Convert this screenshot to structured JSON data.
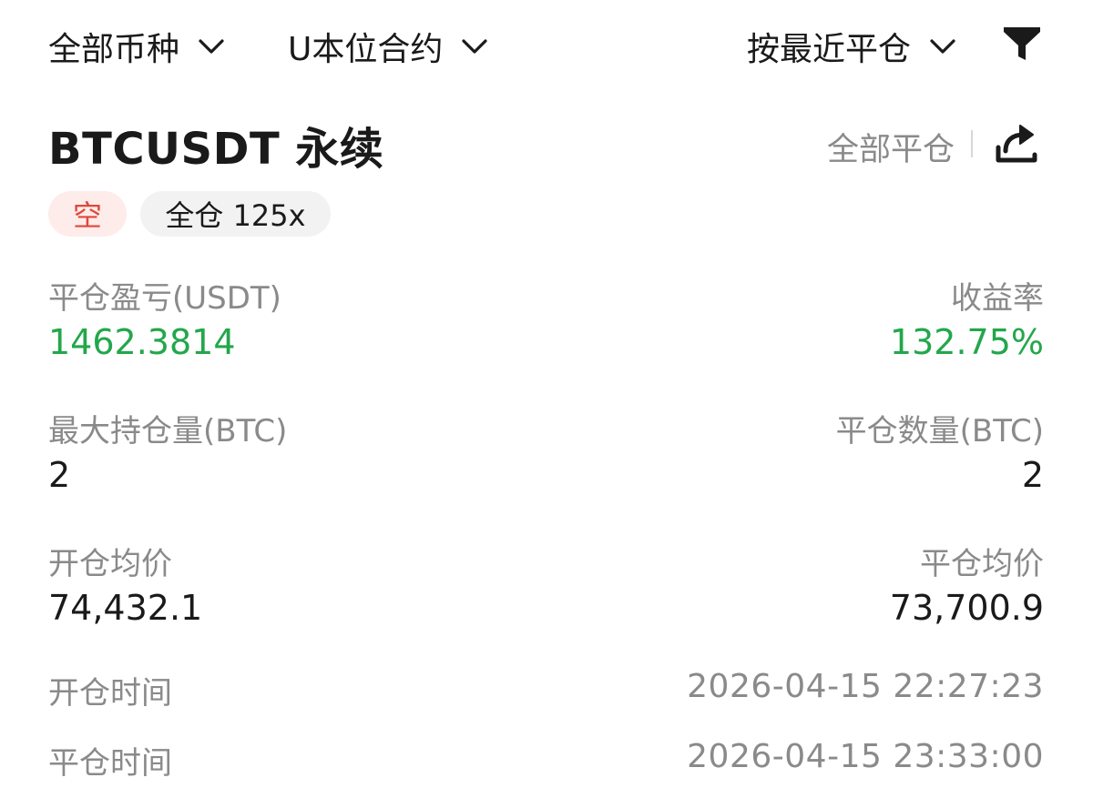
{
  "filters": {
    "coin": "全部币种",
    "contract_type": "U本位合约",
    "sort": "按最近平仓"
  },
  "icons": {
    "dropdown": "chevron-down-icon",
    "filter": "filter-funnel-icon",
    "share": "share-icon"
  },
  "position": {
    "symbol_title": "BTCUSDT 永续",
    "close_all_label": "全部平仓",
    "direction_tag": "空",
    "margin_tag": "全仓 125x"
  },
  "fields": {
    "realized_pnl": {
      "label": "平仓盈亏(USDT)",
      "value": "1462.3814"
    },
    "roe": {
      "label": "收益率",
      "value": "132.75%"
    },
    "max_position": {
      "label": "最大持仓量(BTC)",
      "value": "2"
    },
    "closed_qty": {
      "label": "平仓数量(BTC)",
      "value": "2"
    },
    "avg_open_price": {
      "label": "开仓均价",
      "value": "74,432.1"
    },
    "avg_close_price": {
      "label": "平仓均价",
      "value": "73,700.9"
    },
    "open_time": {
      "label": "开仓时间",
      "value": "2026-04-15 22:27:23"
    },
    "close_time": {
      "label": "平仓时间",
      "value": "2026-04-15 23:33:00"
    }
  },
  "colors": {
    "profit_green": "#22a74b",
    "short_red": "#e0483a",
    "short_bg": "#fdecea",
    "muted_text": "#8a8a8a"
  }
}
